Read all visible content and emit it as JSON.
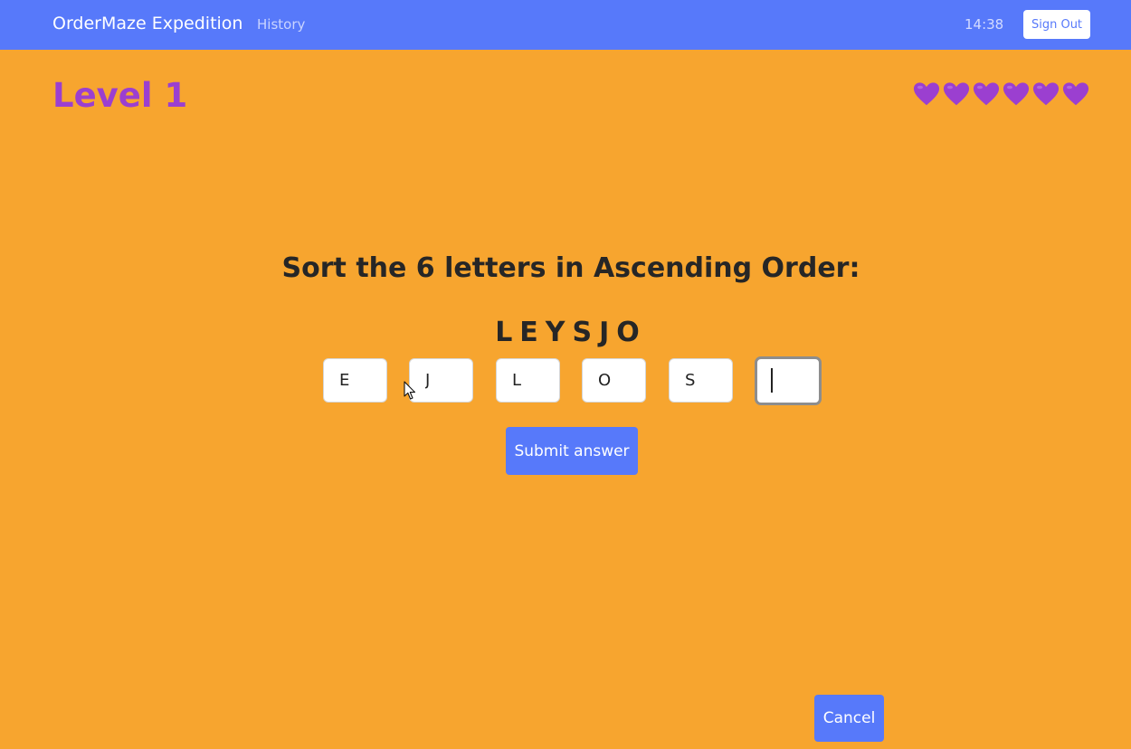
{
  "navbar": {
    "brand": "OrderMaze Expedition",
    "history_label": "History",
    "time": "14:38",
    "signout_label": "Sign Out"
  },
  "game": {
    "level_label": "Level 1",
    "lives": 6,
    "life_icon": "purple-heart",
    "prompt": "Sort the 6 letters in Ascending Order:",
    "scrambled": "LEYSJO",
    "answers": [
      "E",
      "J",
      "L",
      "O",
      "S",
      ""
    ],
    "focused_slot": 6,
    "submit_label": "Submit answer",
    "cancel_label": "Cancel"
  },
  "colors": {
    "background": "#F7A52F",
    "navbar": "#5779FA",
    "accent": "#9B3FD0",
    "button": "#5779FA",
    "text": "#262626"
  }
}
